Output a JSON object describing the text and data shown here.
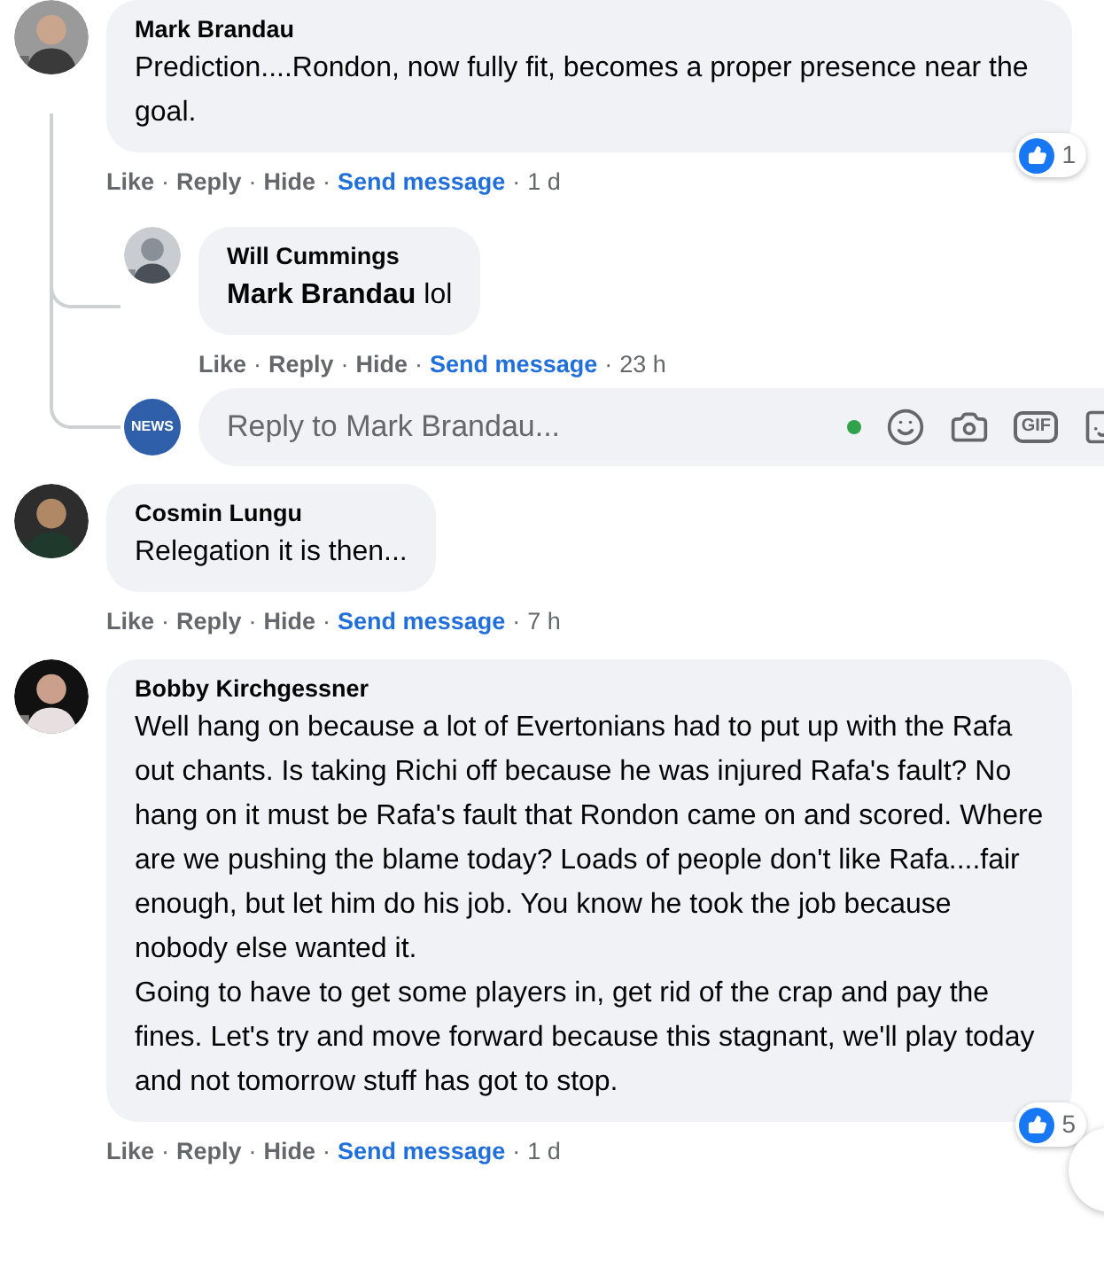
{
  "comments": [
    {
      "author": "Mark Brandau",
      "separator": "·",
      "paragraphs": [
        "Prediction....Rondon, now fully fit, becomes a proper presence near the goal."
      ],
      "reactions": "1",
      "actions": [
        "Like",
        "Reply",
        "Hide"
      ],
      "send_message": "Send message",
      "time": "1 d",
      "replies": [
        {
          "author": "Will Cummings",
          "separator": "·",
          "paragraphs": [
            "**Mark Brandau** lol"
          ],
          "actions": [
            "Like",
            "Reply",
            "Hide"
          ],
          "send_message": "Send message",
          "time": "23 h"
        }
      ],
      "composer": {
        "avatar_text": "NEWS",
        "placeholder": "Reply to Mark Brandau...",
        "online": true,
        "gif_label": "GIF"
      }
    },
    {
      "author": "Cosmin Lungu",
      "separator": "·",
      "paragraphs": [
        "Relegation it is then..."
      ],
      "actions": [
        "Like",
        "Reply",
        "Hide"
      ],
      "send_message": "Send message",
      "time": "7 h"
    },
    {
      "author": "Bobby Kirchgessner",
      "separator": "·",
      "paragraphs": [
        "Well hang on because a lot of Evertonians had to put up with the Rafa out chants. Is taking Richi off because he was injured Rafa's fault? No hang on it must be Rafa's fault that Rondon came on and scored. Where are we pushing the blame today? Loads of people don't like Rafa....fair enough, but let him do his job. You know he took the job because nobody else wanted it.",
        "Going to have to get some players in, get rid of the crap and pay the fines. Let's try and move forward because this stagnant, we'll play today and not tomorrow stuff has got to stop."
      ],
      "reactions": "5",
      "actions": [
        "Like",
        "Reply",
        "Hide"
      ],
      "send_message": "Send message",
      "time": "1 d"
    }
  ]
}
